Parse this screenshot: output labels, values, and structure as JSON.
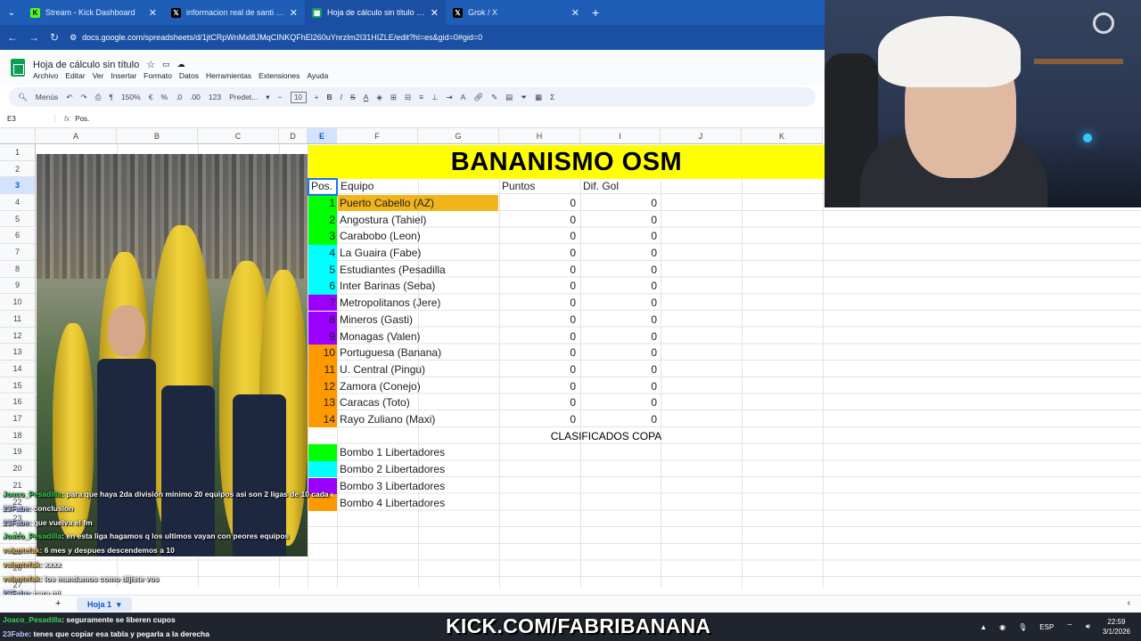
{
  "browser": {
    "tabs": [
      {
        "label": "Stream - Kick Dashboard",
        "favicon": "kick-icon",
        "color": "#53fc18",
        "active": false
      },
      {
        "label": "informacion real de santi sosa e",
        "favicon": "x-icon",
        "color": "#000000",
        "active": false
      },
      {
        "label": "Hoja de cálculo sin título - Hoja",
        "favicon": "sheets-icon",
        "color": "#0f9d58",
        "active": true
      },
      {
        "label": "Grok / X",
        "favicon": "x-icon",
        "color": "#000000",
        "active": false
      }
    ],
    "url": "docs.google.com/spreadsheets/d/1jtCRpWnMxl8JMqCINKQFhEl260uYnrzlm2I31HIZLE/edit?hl=es&gid=0#gid=0"
  },
  "sheets": {
    "title": "Hoja de cálculo sin título",
    "menus": [
      "Archivo",
      "Editar",
      "Ver",
      "Insertar",
      "Formato",
      "Datos",
      "Herramientas",
      "Extensiones",
      "Ayuda"
    ],
    "toolbar": {
      "menus_label": "Menús",
      "zoom": "150%",
      "currency": "€",
      "percent": "%",
      "dec_less": ".0",
      "dec_more": ".00",
      "number_format": "123",
      "font": "Predet...",
      "font_size": "10"
    },
    "name_box": "E3",
    "formula": "Pos.",
    "columns": [
      "A",
      "B",
      "C",
      "D",
      "E",
      "F",
      "G",
      "H",
      "I",
      "J",
      "K"
    ],
    "rows": [
      "1",
      "2",
      "3",
      "4",
      "5",
      "6",
      "7",
      "8",
      "9",
      "10",
      "11",
      "12",
      "13",
      "14",
      "15",
      "16",
      "17",
      "18",
      "19",
      "20",
      "21",
      "22",
      "23",
      "24",
      "25",
      "26",
      "27"
    ],
    "sheet_tab": "Hoja 1"
  },
  "table": {
    "title": "BANANISMO OSM",
    "headers": {
      "pos": "Pos.",
      "team": "Equipo",
      "points": "Puntos",
      "goal_diff": "Dif. Gol"
    },
    "rows": [
      {
        "pos": "1",
        "team": "Puerto Cabello (AZ)",
        "points": "0",
        "gd": "0",
        "color": "#00ff00",
        "team_bg": "#f1b41b"
      },
      {
        "pos": "2",
        "team": "Angostura (Tahiel)",
        "points": "0",
        "gd": "0",
        "color": "#00ff00",
        "team_bg": ""
      },
      {
        "pos": "3",
        "team": "Carabobo (Leon)",
        "points": "0",
        "gd": "0",
        "color": "#00ff00",
        "team_bg": ""
      },
      {
        "pos": "4",
        "team": "La Guaira (Fabe)",
        "points": "0",
        "gd": "0",
        "color": "#00ffff",
        "team_bg": ""
      },
      {
        "pos": "5",
        "team": "Estudiantes (Pesadilla",
        "points": "0",
        "gd": "0",
        "color": "#00ffff",
        "team_bg": ""
      },
      {
        "pos": "6",
        "team": "Inter Barinas (Seba)",
        "points": "0",
        "gd": "0",
        "color": "#00ffff",
        "team_bg": ""
      },
      {
        "pos": "7",
        "team": "Metropolitanos (Jere)",
        "points": "0",
        "gd": "0",
        "color": "#9900ff",
        "team_bg": ""
      },
      {
        "pos": "8",
        "team": "Mineros (Gasti)",
        "points": "0",
        "gd": "0",
        "color": "#9900ff",
        "team_bg": ""
      },
      {
        "pos": "9",
        "team": "Monagas (Valen)",
        "points": "0",
        "gd": "0",
        "color": "#9900ff",
        "team_bg": ""
      },
      {
        "pos": "10",
        "team": "Portuguesa (Banana)",
        "points": "0",
        "gd": "0",
        "color": "#ff9900",
        "team_bg": ""
      },
      {
        "pos": "11",
        "team": "U. Central (Pingu)",
        "points": "0",
        "gd": "0",
        "color": "#ff9900",
        "team_bg": ""
      },
      {
        "pos": "12",
        "team": "Zamora (Conejo)",
        "points": "0",
        "gd": "0",
        "color": "#ff9900",
        "team_bg": ""
      },
      {
        "pos": "13",
        "team": "Caracas (Toto)",
        "points": "0",
        "gd": "0",
        "color": "#ff9900",
        "team_bg": ""
      },
      {
        "pos": "14",
        "team": "Rayo Zuliano (Maxi)",
        "points": "0",
        "gd": "0",
        "color": "#ff9900",
        "team_bg": ""
      }
    ],
    "clasificados_label": "CLASIFICADOS COPA",
    "legend": [
      {
        "label": "Bombo 1 Libertadores",
        "color": "#00ff00"
      },
      {
        "label": "Bombo 2 Libertadores",
        "color": "#00ffff"
      },
      {
        "label": "Bombo 3 Libertadores",
        "color": "#9900ff"
      },
      {
        "label": "Bombo 4 Libertadores",
        "color": "#ff9900"
      }
    ]
  },
  "chat": [
    {
      "user": "Joaco_Pesadilla",
      "msg": "para que haya 2da división mínimo 20 equipos asi son 2 ligas de 10 cada una"
    },
    {
      "user": "23Fabe",
      "msg": "conclusion"
    },
    {
      "user": "23Fabe",
      "msg": "que vuelva el fm"
    },
    {
      "user": "Joaco_Pesadilla",
      "msg": "en esta liga hagamos q los ultimos vayan con peores equipos"
    },
    {
      "user": "valentefak",
      "msg": "6 mes y despues descendemos a 10"
    },
    {
      "user": "valentefak",
      "msg": "xxxx"
    },
    {
      "user": "valentefak",
      "msg": "los mandamos como dijiste vos"
    },
    {
      "user": "23Fabe",
      "msg": "para mi"
    }
  ],
  "bottom_chat": [
    {
      "user": "Joaco_Pesadilla",
      "msg": "seguramente se liberen cupos"
    },
    {
      "user": "23Fabe",
      "msg": "tenes que copiar esa tabla y pegarla a la derecha"
    }
  ],
  "overlay": {
    "kick_url": "KICK.COM/FABRIBANANA"
  },
  "tray": {
    "lang": "ESP",
    "time": "22:59",
    "date": "3/1/2026"
  }
}
